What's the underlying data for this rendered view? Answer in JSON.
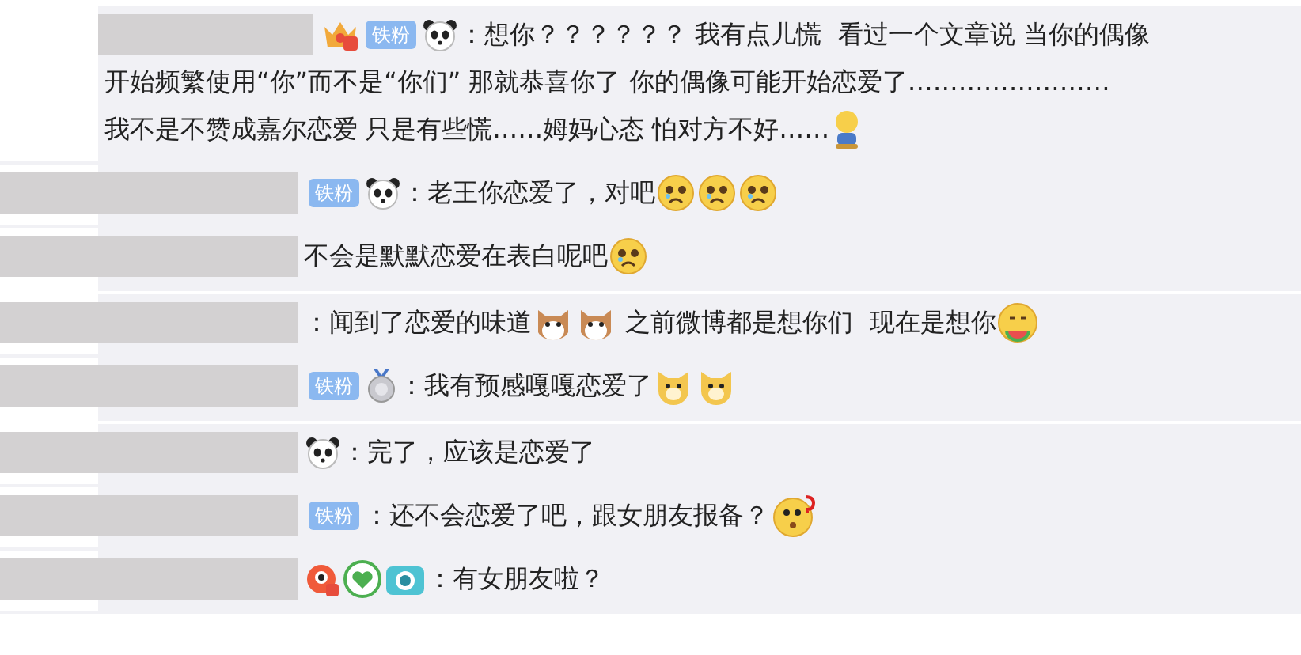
{
  "comments": [
    {
      "badges": [
        {
          "kind": "crown"
        },
        {
          "kind": "fan",
          "label": "铁粉"
        },
        {
          "kind": "panda"
        }
      ],
      "lines": [
        [
          {
            "kind": "text",
            "text": "：想你？？？？？？ 我有点儿慌  看过一个文章说 当你的偶像"
          }
        ],
        [
          {
            "kind": "text",
            "text": "开始频繁使用“你”而不是“你们” 那就恭喜你了 你的偶像可能开始恋爱了……………………"
          }
        ],
        [
          {
            "kind": "text",
            "text": "我不是不赞成嘉尔恋爱 只是有些慌……姆妈心态 怕对方不好……"
          },
          {
            "kind": "sitting"
          }
        ]
      ],
      "divider": false
    },
    {
      "badges": [
        {
          "kind": "fan",
          "label": "铁粉"
        },
        {
          "kind": "panda"
        }
      ],
      "lines": [
        [
          {
            "kind": "text",
            "text": "：老王你恋爱了，对吧"
          },
          {
            "kind": "cry"
          },
          {
            "kind": "cry"
          },
          {
            "kind": "cry"
          }
        ]
      ],
      "divider": false
    },
    {
      "lines": [
        [
          {
            "kind": "text",
            "text": "不会是默默恋爱在表白呢吧"
          },
          {
            "kind": "cry"
          }
        ]
      ],
      "divider": true
    },
    {
      "lines": [
        [
          {
            "kind": "text",
            "text": "：闻到了恋爱的味道"
          },
          {
            "kind": "cat"
          },
          {
            "kind": "cat"
          },
          {
            "kind": "text",
            "text": " 之前微博都是想你们  现在是想你"
          },
          {
            "kind": "melon"
          }
        ]
      ],
      "divider": false
    },
    {
      "badges": [
        {
          "kind": "fan",
          "label": "铁粉"
        },
        {
          "kind": "medal"
        }
      ],
      "lines": [
        [
          {
            "kind": "text",
            "text": "：我有预感嘎嘎恋爱了"
          },
          {
            "kind": "dog"
          },
          {
            "kind": "dog"
          }
        ]
      ],
      "divider": true
    },
    {
      "badges": [
        {
          "kind": "panda"
        }
      ],
      "lines": [
        [
          {
            "kind": "text",
            "text": "：完了，应该是恋爱了"
          }
        ]
      ],
      "divider": false
    },
    {
      "badges": [
        {
          "kind": "fan",
          "label": "铁粉"
        }
      ],
      "lines": [
        [
          {
            "kind": "text",
            "text": "：还不会恋爱了吧，跟女朋友报备？"
          },
          {
            "kind": "question"
          }
        ]
      ],
      "divider": false
    },
    {
      "badges": [
        {
          "kind": "parrot"
        },
        {
          "kind": "heart"
        },
        {
          "kind": "camera"
        }
      ],
      "lines": [
        [
          {
            "kind": "text",
            "text": "：有女朋友啦？"
          }
        ]
      ],
      "divider": false
    }
  ]
}
